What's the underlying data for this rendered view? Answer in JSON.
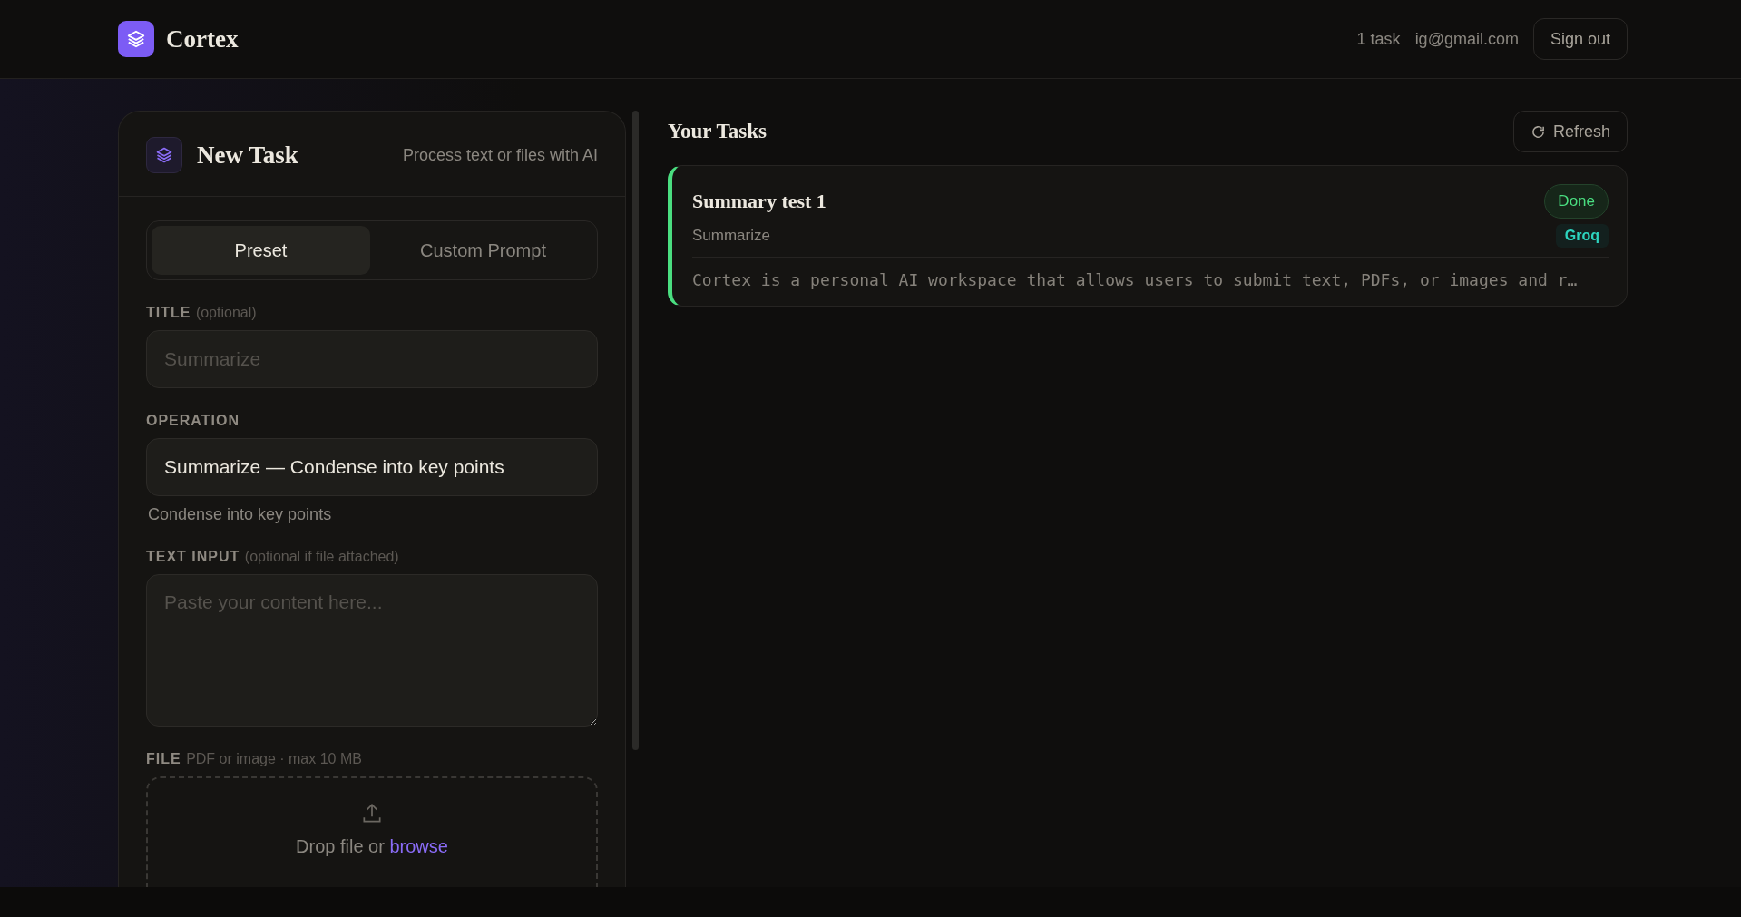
{
  "header": {
    "brand": "Cortex",
    "task_count": "1 task",
    "email": "ig@gmail.com",
    "sign_out": "Sign out"
  },
  "new_task": {
    "title": "New Task",
    "subtitle": "Process text or files with AI",
    "tabs": [
      {
        "label": "Preset",
        "selected": true
      },
      {
        "label": "Custom Prompt",
        "selected": false
      }
    ],
    "title_field": {
      "label": "TITLE",
      "hint": "(optional)",
      "placeholder": "Summarize"
    },
    "operation": {
      "label": "OPERATION",
      "value": "Summarize — Condense into key points",
      "description": "Condense into key points"
    },
    "text_input": {
      "label": "TEXT INPUT",
      "hint": "(optional if file attached)",
      "placeholder": "Paste your content here..."
    },
    "file": {
      "label": "FILE",
      "hint": "PDF or image · max 10 MB",
      "drop_text": "Drop file or",
      "browse": "browse"
    }
  },
  "tasks": {
    "title": "Your Tasks",
    "refresh": "Refresh",
    "items": [
      {
        "title": "Summary test 1",
        "operation": "Summarize",
        "status": {
          "label": "Done",
          "kind": "done"
        },
        "provider": "Groq",
        "preview": "Cortex is a personal AI workspace that allows users to submit text, PDFs, or images and r…"
      }
    ]
  }
}
